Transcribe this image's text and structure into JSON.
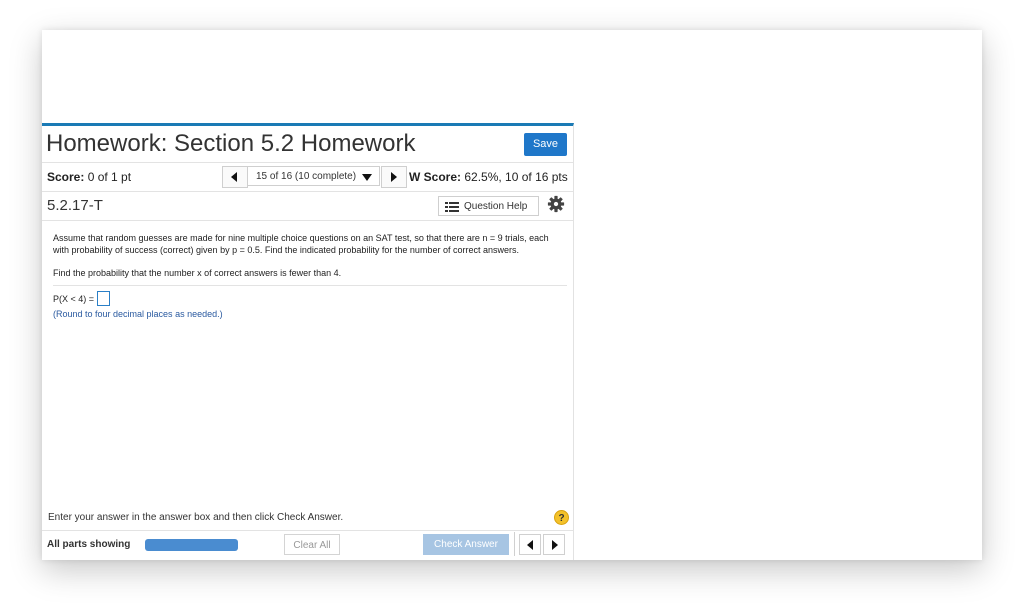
{
  "header": {
    "title": "Homework: Section 5.2 Homework",
    "save_label": "Save"
  },
  "scorebar": {
    "score_label": "Score:",
    "score_value": "0 of 1 pt",
    "question_nav": "15 of 16 (10 complete)",
    "wscore_label": "W Score:",
    "wscore_value": "62.5%, 10 of 16 pts"
  },
  "question": {
    "id": "5.2.17-T",
    "help_label": "Question Help",
    "paragraph1": "Assume that random guesses are made for nine multiple choice questions on an SAT test, so that there are n = 9 trials, each with probability of success (correct) given by p = 0.5. Find the indicated probability for the number of correct answers.",
    "paragraph2": "Find the probability that the number x of correct answers is fewer than 4.",
    "equation_label": "P(X < 4) =",
    "answer_value": "",
    "round_note": "(Round to four decimal places as needed.)"
  },
  "footer": {
    "instruction": "Enter your answer in the answer box and then click Check Answer.",
    "help_mark": "?",
    "parts_label": "All parts showing",
    "clear_label": "Clear All",
    "check_label": "Check Answer"
  },
  "colors": {
    "accent": "#1a7ab5",
    "save_button": "#1f77c9",
    "check_button": "#a7c5e3",
    "progress": "#4a8cd0",
    "help_mark": "#f3c12a"
  }
}
